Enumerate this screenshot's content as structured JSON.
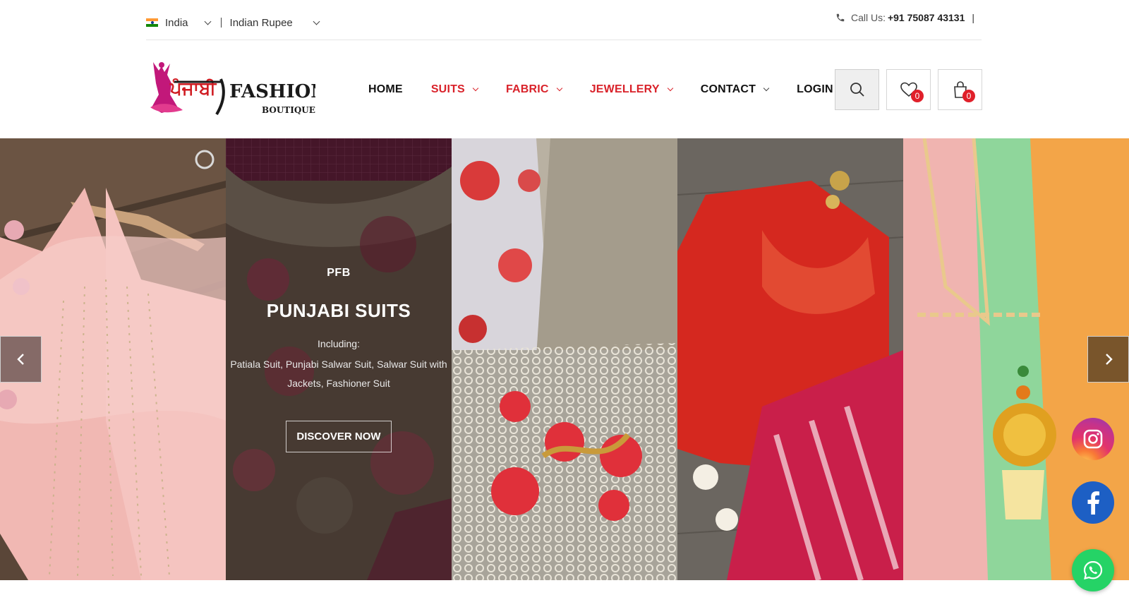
{
  "topbar": {
    "country": "India",
    "currency": "Indian Rupee",
    "call_prefix": "Call Us:",
    "phone": "+91 75087 43131",
    "pipe": "|"
  },
  "brand": {
    "logo_script": "ਪੰਜਾਬੀ",
    "logo_word": "FASHION",
    "logo_sub": "BOUTIQUE"
  },
  "nav": [
    {
      "label": "HOME",
      "color": "#111111",
      "dropdown": false
    },
    {
      "label": "SUITS",
      "color": "#d9222a",
      "dropdown": true
    },
    {
      "label": "FABRIC",
      "color": "#d9222a",
      "dropdown": true
    },
    {
      "label": "JEWELLERY",
      "color": "#d9222a",
      "dropdown": true
    },
    {
      "label": "CONTACT",
      "color": "#111111",
      "dropdown": true
    },
    {
      "label": "LOGIN",
      "color": "#111111",
      "dropdown": false
    }
  ],
  "header_actions": {
    "search_icon": "search-icon",
    "wishlist_count": "0",
    "cart_count": "0"
  },
  "hero": {
    "kicker": "PFB",
    "title": "PUNJABI SUITS",
    "subtitle": "Including:",
    "description": "Patiala Suit, Punjabi Salwar Suit, Salwar Suit with Jackets, Fashioner Suit",
    "cta": "DISCOVER NOW",
    "panels": [
      "pink-suit-on-hanger",
      "embroidered-beige-suit",
      "floral-net-dupatta",
      "red-gota-blouse",
      "pastel-gota-dupatta"
    ]
  },
  "social": [
    "instagram-icon",
    "facebook-icon",
    "whatsapp-icon"
  ],
  "colors": {
    "accent_red": "#d9222a",
    "badge_red": "#e0202a",
    "facebook": "#1d5fc4",
    "whatsapp": "#25d366"
  }
}
